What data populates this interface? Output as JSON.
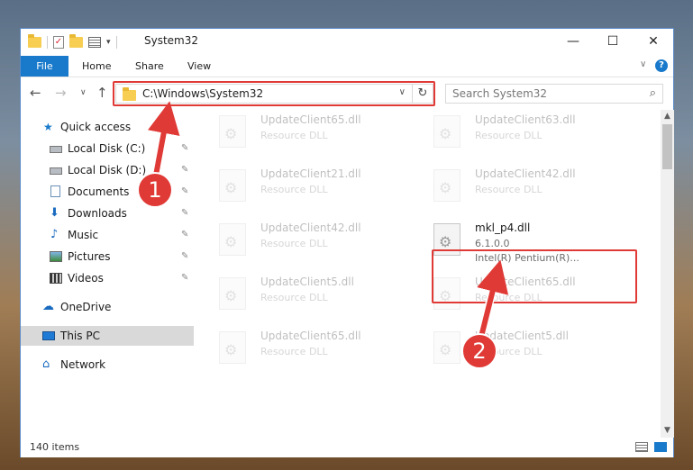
{
  "window": {
    "title": "System32",
    "controls": {
      "minimize": "—",
      "maximize": "☐",
      "close": "✕"
    }
  },
  "ribbon": {
    "tabs": [
      "File",
      "Home",
      "Share",
      "View"
    ],
    "expand_chevron": "∨",
    "help": "?"
  },
  "navigation": {
    "back": "←",
    "forward": "→",
    "recent": "∨",
    "up": "↑",
    "address": "C:\\Windows\\System32",
    "address_dropdown": "∨",
    "refresh": "↻",
    "search_placeholder": "Search System32",
    "search_icon": "⌕"
  },
  "sidebar": {
    "items": [
      {
        "label": "Quick access",
        "icon": "star-icon",
        "glyph": "★"
      },
      {
        "label": "Local Disk (C:)",
        "icon": "disk-icon",
        "pinned": true
      },
      {
        "label": "Local Disk (D:)",
        "icon": "disk-icon",
        "pinned": true
      },
      {
        "label": "Documents",
        "icon": "documents-icon",
        "pinned": true
      },
      {
        "label": "Downloads",
        "icon": "download-icon",
        "glyph": "⬇",
        "pinned": true
      },
      {
        "label": "Music",
        "icon": "music-icon",
        "glyph": "♪",
        "pinned": true
      },
      {
        "label": "Pictures",
        "icon": "pictures-icon",
        "pinned": true
      },
      {
        "label": "Videos",
        "icon": "videos-icon",
        "pinned": true
      },
      {
        "label": "OneDrive",
        "icon": "cloud-icon",
        "glyph": "☁"
      },
      {
        "label": "This PC",
        "icon": "computer-icon",
        "selected": true
      },
      {
        "label": "Network",
        "icon": "network-icon",
        "glyph": "⌂"
      }
    ],
    "pin_glyph": "✎"
  },
  "files": [
    {
      "name": "UpdateClient65.dll",
      "desc": "Resource DLL",
      "faded": true
    },
    {
      "name": "UpdateClient63.dll",
      "desc": "Resource DLL",
      "faded": true
    },
    {
      "name": "UpdateClient21.dll",
      "desc": "Resource DLL",
      "faded": true
    },
    {
      "name": "UpdateClient42.dll",
      "desc": "Resource DLL",
      "faded": true
    },
    {
      "name": "UpdateClient42.dll",
      "desc": "Resource DLL",
      "faded": true
    },
    {
      "name": "mkl_p4.dll",
      "desc": "6.1.0.0",
      "extra": "Intel(R) Pentium(R)...",
      "faded": false
    },
    {
      "name": "UpdateClient5.dll",
      "desc": "Resource DLL",
      "faded": true
    },
    {
      "name": "UpdateClient65.dll",
      "desc": "Resource DLL",
      "faded": true
    },
    {
      "name": "UpdateClient65.dll",
      "desc": "Resource DLL",
      "faded": true
    },
    {
      "name": "UpdateClient5.dll",
      "desc": "Resource DLL",
      "faded": true
    }
  ],
  "status": {
    "item_count": "140 items"
  },
  "annotations": {
    "callout_1": "1",
    "callout_2": "2",
    "highlight_color": "#e03a36"
  },
  "colors": {
    "accent": "#1979ca",
    "selected": "#d9d9d9"
  }
}
